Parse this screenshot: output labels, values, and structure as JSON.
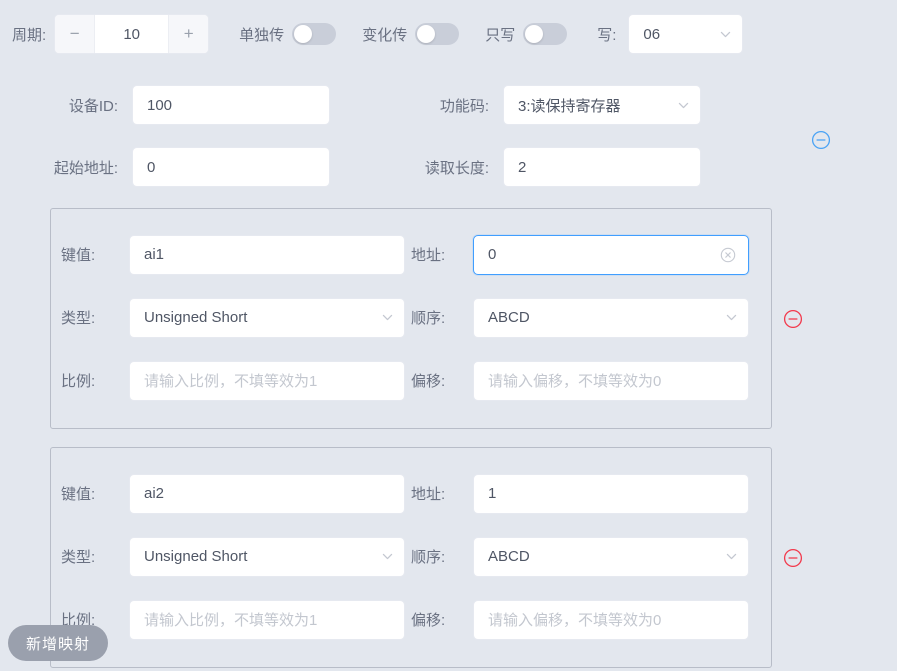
{
  "colors": {
    "page_background": "#e3e7ee",
    "input_background": "#ffffff",
    "label_text": "#6a7182",
    "value_text": "#4f5665",
    "placeholder_text": "#c3c7cf",
    "focus_blue": "#409eff",
    "remove_red": "#f56c6c",
    "card_border": "#b8bdc8",
    "add_button": "#9aa0ad"
  },
  "toolbar": {
    "period_label": "周期:",
    "period_value": "10",
    "decrement_icon": "minus-icon",
    "increment_icon": "plus-icon",
    "single_transmit_label": "单独传",
    "single_transmit_on": false,
    "change_transmit_label": "变化传",
    "change_transmit_on": false,
    "write_only_label": "只写",
    "write_only_on": false,
    "write_label": "写:",
    "write_value": "06",
    "write_chevron_icon": "chevron-down-icon"
  },
  "header_form": {
    "device_id_label": "设备ID:",
    "device_id_value": "100",
    "function_code_label": "功能码:",
    "function_code_value": "3:读保持寄存器",
    "start_address_label": "起始地址:",
    "start_address_value": "0",
    "read_length_label": "读取长度:",
    "read_length_value": "2",
    "remove_icon": "circle-minus-icon"
  },
  "mapping_cards": [
    {
      "key_label": "键值:",
      "key_value": "ai1",
      "address_label": "地址:",
      "address_value": "0",
      "address_focused": true,
      "address_clear_icon": "circle-close-icon",
      "type_label": "类型:",
      "type_value": "Unsigned Short",
      "order_label": "顺序:",
      "order_value": "ABCD",
      "scale_label": "比例:",
      "scale_value": "",
      "scale_placeholder": "请输入比例，不填等效为1",
      "offset_label": "偏移:",
      "offset_value": "",
      "offset_placeholder": "请输入偏移，不填等效为0",
      "remove_icon": "circle-minus-icon"
    },
    {
      "key_label": "键值:",
      "key_value": "ai2",
      "address_label": "地址:",
      "address_value": "1",
      "address_focused": false,
      "address_clear_icon": "",
      "type_label": "类型:",
      "type_value": "Unsigned Short",
      "order_label": "顺序:",
      "order_value": "ABCD",
      "scale_label": "比例:",
      "scale_value": "",
      "scale_placeholder": "请输入比例，不填等效为1",
      "offset_label": "偏移:",
      "offset_value": "",
      "offset_placeholder": "请输入偏移，不填等效为0",
      "remove_icon": "circle-minus-icon"
    }
  ],
  "footer": {
    "add_mapping_label": "新增映射"
  }
}
